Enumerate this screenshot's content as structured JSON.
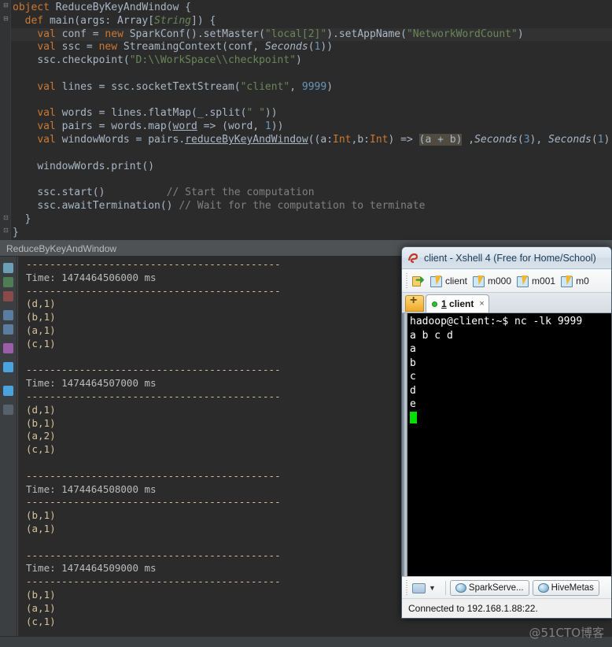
{
  "editor": {
    "lines": [
      {
        "indent": 0,
        "current": false,
        "tokens": [
          {
            "t": "object ",
            "c": "kw"
          },
          {
            "t": "ReduceByKeyAndWindow {",
            "c": "typ"
          }
        ]
      },
      {
        "indent": 1,
        "current": false,
        "tokens": [
          {
            "t": "def ",
            "c": "kw"
          },
          {
            "t": "main(args: Array[",
            "c": "typ"
          },
          {
            "t": "String",
            "c": "grn"
          },
          {
            "t": "]) {",
            "c": "typ"
          }
        ]
      },
      {
        "indent": 2,
        "current": true,
        "tokens": [
          {
            "t": "val ",
            "c": "kw"
          },
          {
            "t": "conf = ",
            "c": "typ"
          },
          {
            "t": "new ",
            "c": "kw"
          },
          {
            "t": "SparkConf().setMaster(",
            "c": "typ"
          },
          {
            "t": "\"local[2]\"",
            "c": "str"
          },
          {
            "t": ").setAppName(",
            "c": "typ"
          },
          {
            "t": "\"NetworkWordCount\"",
            "c": "str"
          },
          {
            "t": ")",
            "c": "typ"
          }
        ]
      },
      {
        "indent": 2,
        "current": false,
        "tokens": [
          {
            "t": "val ",
            "c": "kw"
          },
          {
            "t": "ssc = ",
            "c": "typ"
          },
          {
            "t": "new ",
            "c": "kw"
          },
          {
            "t": "StreamingContext(conf, ",
            "c": "typ"
          },
          {
            "t": "Seconds",
            "c": "ital"
          },
          {
            "t": "(",
            "c": "typ"
          },
          {
            "t": "1",
            "c": "num"
          },
          {
            "t": "))",
            "c": "typ"
          }
        ]
      },
      {
        "indent": 2,
        "current": false,
        "tokens": [
          {
            "t": "ssc.checkpoint(",
            "c": "typ"
          },
          {
            "t": "\"D:\\\\WorkSpace\\\\checkpoint\"",
            "c": "str"
          },
          {
            "t": ")",
            "c": "typ"
          }
        ]
      },
      {
        "indent": 0,
        "current": false,
        "tokens": []
      },
      {
        "indent": 2,
        "current": false,
        "tokens": [
          {
            "t": "val ",
            "c": "kw"
          },
          {
            "t": "lines = ssc.socketTextStream(",
            "c": "typ"
          },
          {
            "t": "\"client\"",
            "c": "str"
          },
          {
            "t": ", ",
            "c": "typ"
          },
          {
            "t": "9999",
            "c": "num"
          },
          {
            "t": ")",
            "c": "typ"
          }
        ]
      },
      {
        "indent": 0,
        "current": false,
        "tokens": []
      },
      {
        "indent": 2,
        "current": false,
        "tokens": [
          {
            "t": "val ",
            "c": "kw"
          },
          {
            "t": "words = lines.flatMap(_.split(",
            "c": "typ"
          },
          {
            "t": "\" \"",
            "c": "str"
          },
          {
            "t": "))",
            "c": "typ"
          }
        ]
      },
      {
        "indent": 2,
        "current": false,
        "tokens": [
          {
            "t": "val ",
            "c": "kw"
          },
          {
            "t": "pairs = words.map(",
            "c": "typ"
          },
          {
            "t": "word",
            "c": "und"
          },
          {
            "t": " => (word, ",
            "c": "typ"
          },
          {
            "t": "1",
            "c": "num"
          },
          {
            "t": "))",
            "c": "typ"
          }
        ]
      },
      {
        "indent": 2,
        "current": false,
        "tokens": [
          {
            "t": "val ",
            "c": "kw"
          },
          {
            "t": "windowWords = pairs.",
            "c": "typ"
          },
          {
            "t": "reduceByKeyAndWindow",
            "c": "und"
          },
          {
            "t": "((a:",
            "c": "typ"
          },
          {
            "t": "Int",
            "c": "param"
          },
          {
            "t": ",b:",
            "c": "typ"
          },
          {
            "t": "Int",
            "c": "param"
          },
          {
            "t": ") => ",
            "c": "typ"
          },
          {
            "t": "(a + b)",
            "c": "hl"
          },
          {
            "t": " ,",
            "c": "typ"
          },
          {
            "t": "Seconds",
            "c": "ital"
          },
          {
            "t": "(",
            "c": "typ"
          },
          {
            "t": "3",
            "c": "num"
          },
          {
            "t": "), ",
            "c": "typ"
          },
          {
            "t": "Seconds",
            "c": "ital"
          },
          {
            "t": "(",
            "c": "typ"
          },
          {
            "t": "1",
            "c": "num"
          },
          {
            "t": ")",
            "c": "typ"
          }
        ]
      },
      {
        "indent": 0,
        "current": false,
        "tokens": []
      },
      {
        "indent": 2,
        "current": false,
        "tokens": [
          {
            "t": "windowWords.print()",
            "c": "typ"
          }
        ]
      },
      {
        "indent": 0,
        "current": false,
        "tokens": []
      },
      {
        "indent": 2,
        "current": false,
        "tokens": [
          {
            "t": "ssc.start()          ",
            "c": "typ"
          },
          {
            "t": "// Start the computation",
            "c": "cmt"
          }
        ]
      },
      {
        "indent": 2,
        "current": false,
        "tokens": [
          {
            "t": "ssc.awaitTermination() ",
            "c": "typ"
          },
          {
            "t": "// Wait for the computation to terminate",
            "c": "cmt"
          }
        ]
      },
      {
        "indent": 1,
        "current": false,
        "tokens": [
          {
            "t": "}",
            "c": "typ"
          }
        ]
      },
      {
        "indent": 0,
        "current": false,
        "tokens": [
          {
            "t": "}",
            "c": "typ"
          }
        ]
      }
    ]
  },
  "console": {
    "tab_label": "ReduceByKeyAndWindow",
    "separator": "-------------------------------------------",
    "batches": [
      {
        "time_label": "Time: 1474464506000 ms",
        "pairs": [
          "(d,1)",
          "(b,1)",
          "(a,1)",
          "(c,1)"
        ]
      },
      {
        "time_label": "Time: 1474464507000 ms",
        "pairs": [
          "(d,1)",
          "(b,1)",
          "(a,2)",
          "(c,1)"
        ]
      },
      {
        "time_label": "Time: 1474464508000 ms",
        "pairs": [
          "(b,1)",
          "(a,1)"
        ]
      },
      {
        "time_label": "Time: 1474464509000 ms",
        "pairs": [
          "(b,1)",
          "(a,1)",
          "(c,1)"
        ]
      }
    ]
  },
  "xshell": {
    "title": "client - Xshell 4 (Free for Home/School)",
    "toolbar": {
      "open_label": "",
      "sessions": [
        "client",
        "m000",
        "m001",
        "m0"
      ]
    },
    "tabs": {
      "new_tab_label": "+",
      "active": {
        "number": "1",
        "name": "client",
        "close": "×"
      }
    },
    "terminal": {
      "lines": [
        "hadoop@client:~$ nc -lk 9999",
        "a b c d",
        "a",
        "b",
        "c",
        "d",
        "e"
      ]
    },
    "bottom_buttons": [
      "SparkServe...",
      "HiveMetas"
    ],
    "status": "Connected to 192.168.1.88:22."
  },
  "watermark": "@51CTO博客",
  "colors": {
    "editor_bg": "#2b2b2b",
    "panel_bg": "#3c3f41",
    "keyword": "#cc7832",
    "string": "#6a8759",
    "number": "#6897bb",
    "comment": "#808080",
    "console_pair": "#d6c39a",
    "cursor_green": "#00e000"
  }
}
